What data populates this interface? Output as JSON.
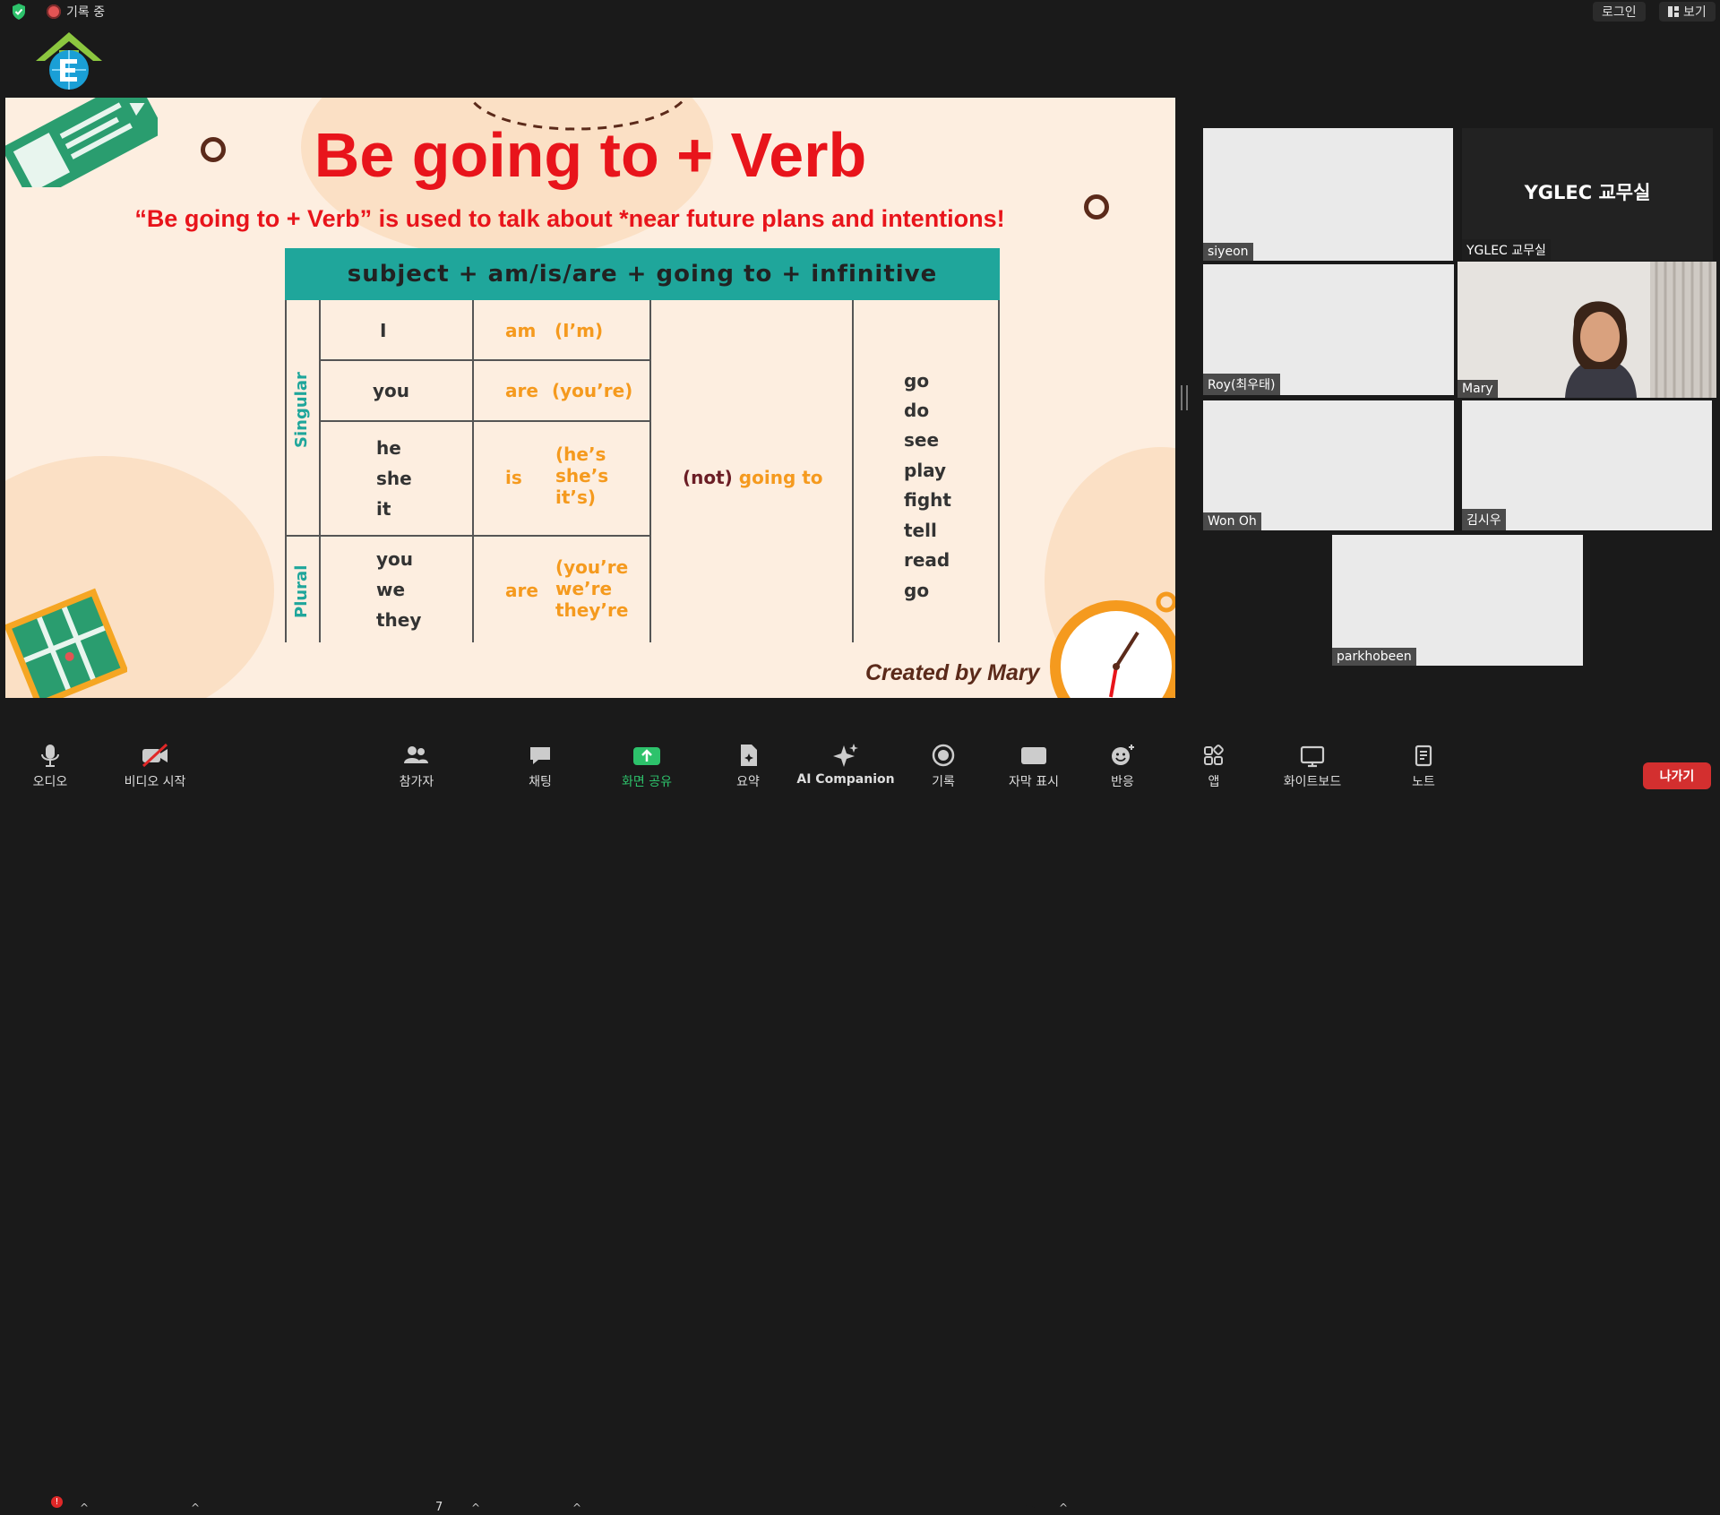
{
  "topbar": {
    "recording_label": "기록 중",
    "login_label": "로그인",
    "view_label": "보기"
  },
  "slide": {
    "title": "Be going to + Verb",
    "subtitle": "“Be going to + Verb” is used to talk about *near future plans and intentions!",
    "table": {
      "header": "subject + am/is/are + going to + infinitive",
      "singular_label": "Singular",
      "plural_label": "Plural",
      "rows": [
        {
          "subject": "I",
          "be": "am",
          "contraction": "(I’m)"
        },
        {
          "subject": "you",
          "be": "are",
          "contraction": "(you’re)"
        },
        {
          "subject": "he\nshe\nit",
          "be": "is",
          "contraction": "(he’s\nshe’s\nit’s)"
        },
        {
          "subject": "you\nwe\nthey",
          "be": "are",
          "contraction": "(you’re\nwe’re\nthey’re"
        }
      ],
      "not_label": "(not)",
      "going_to_label": "going to",
      "verbs": [
        "go",
        "do",
        "see",
        "play",
        "fight",
        "tell",
        "read",
        "go"
      ]
    },
    "credit": "Created by Mary"
  },
  "participants": [
    {
      "name": "siyeon"
    },
    {
      "name": "YGLEC 교무실",
      "display": "YGLEC 교무실"
    },
    {
      "name": "Roy(최우태)"
    },
    {
      "name": "Mary"
    },
    {
      "name": "Won Oh"
    },
    {
      "name": "김시우"
    },
    {
      "name": "parkhobeen"
    }
  ],
  "toolbar": {
    "audio": "오디오",
    "audio_badge": "!",
    "video": "비디오 시작",
    "participants": "참가자",
    "participants_count": "7",
    "chat": "채팅",
    "share": "화면 공유",
    "summary": "요약",
    "ai": "AI Companion",
    "record": "기록",
    "captions": "자막 표시",
    "captions_icon": "CC",
    "reactions": "반응",
    "apps": "앱",
    "whiteboard": "화이트보드",
    "notes": "노트",
    "leave": "나가기"
  },
  "colors": {
    "accent_green": "#2dc26b",
    "slide_red": "#e8141b",
    "teal": "#1fa69b",
    "orange": "#f59a1e",
    "leave_red": "#d32f2f"
  }
}
